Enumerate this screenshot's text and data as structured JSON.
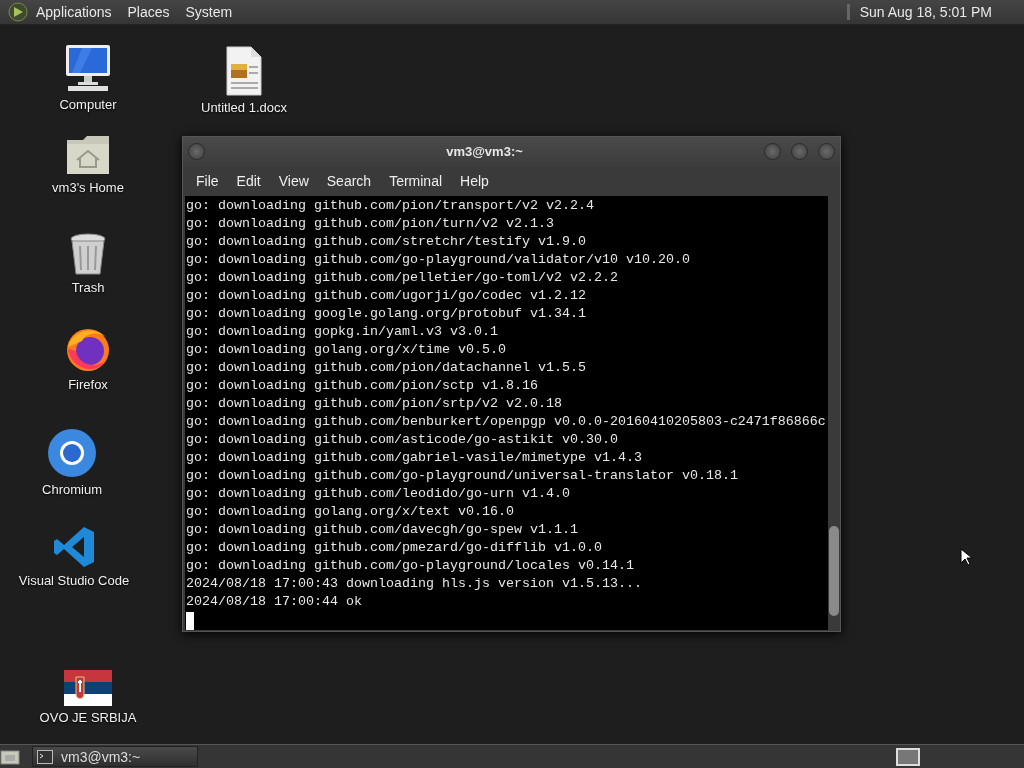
{
  "top_panel": {
    "menus": [
      "Applications",
      "Places",
      "System"
    ],
    "clock": "Sun Aug 18,  5:01 PM"
  },
  "desktop_icons": [
    {
      "kind": "computer",
      "label": "Computer"
    },
    {
      "kind": "document",
      "label": "Untitled 1.docx"
    },
    {
      "kind": "home",
      "label": "vm3's Home"
    },
    {
      "kind": "trash",
      "label": "Trash"
    },
    {
      "kind": "firefox",
      "label": "Firefox"
    },
    {
      "kind": "chromium",
      "label": "Chromium"
    },
    {
      "kind": "vscode",
      "label": "Visual Studio Code"
    },
    {
      "kind": "flag",
      "label": "OVO JE SRBIJA"
    }
  ],
  "terminal": {
    "title": "vm3@vm3:~",
    "menu": [
      "File",
      "Edit",
      "View",
      "Search",
      "Terminal",
      "Help"
    ],
    "lines": [
      "go: downloading github.com/pion/transport/v2 v2.2.4",
      "go: downloading github.com/pion/turn/v2 v2.1.3",
      "go: downloading github.com/stretchr/testify v1.9.0",
      "go: downloading github.com/go-playground/validator/v10 v10.20.0",
      "go: downloading github.com/pelletier/go-toml/v2 v2.2.2",
      "go: downloading github.com/ugorji/go/codec v1.2.12",
      "go: downloading google.golang.org/protobuf v1.34.1",
      "go: downloading gopkg.in/yaml.v3 v3.0.1",
      "go: downloading golang.org/x/time v0.5.0",
      "go: downloading github.com/pion/datachannel v1.5.5",
      "go: downloading github.com/pion/sctp v1.8.16",
      "go: downloading github.com/pion/srtp/v2 v2.0.18",
      "go: downloading github.com/benburkert/openpgp v0.0.0-20160410205803-c2471f86866c",
      "go: downloading github.com/asticode/go-astikit v0.30.0",
      "go: downloading github.com/gabriel-vasile/mimetype v1.4.3",
      "go: downloading github.com/go-playground/universal-translator v0.18.1",
      "go: downloading github.com/leodido/go-urn v1.4.0",
      "go: downloading golang.org/x/text v0.16.0",
      "go: downloading github.com/davecgh/go-spew v1.1.1",
      "go: downloading github.com/pmezard/go-difflib v1.0.0",
      "go: downloading github.com/go-playground/locales v0.14.1",
      "2024/08/18 17:00:43 downloading hls.js version v1.5.13...",
      "2024/08/18 17:00:44 ok"
    ]
  },
  "taskbar": {
    "tasks": [
      {
        "label": "vm3@vm3:~"
      }
    ]
  }
}
